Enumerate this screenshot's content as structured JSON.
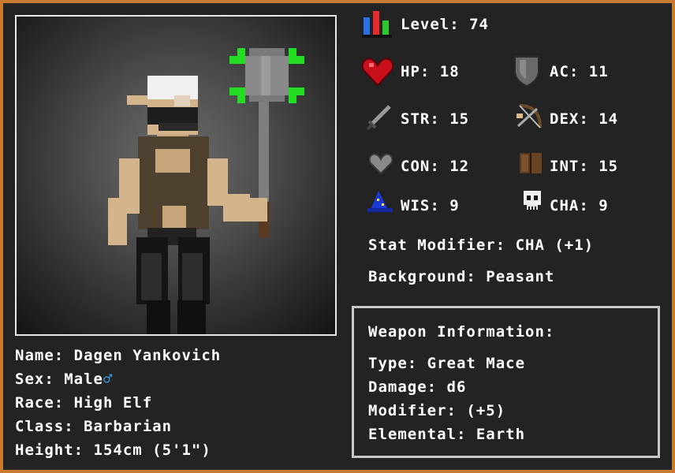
{
  "level": {
    "label": "Level:",
    "value": "74"
  },
  "stats": {
    "hp": {
      "label": "HP:",
      "value": "18"
    },
    "ac": {
      "label": "AC:",
      "value": "11"
    },
    "str": {
      "label": "STR:",
      "value": "15"
    },
    "dex": {
      "label": "DEX:",
      "value": "14"
    },
    "con": {
      "label": "CON:",
      "value": "12"
    },
    "int": {
      "label": "INT:",
      "value": "15"
    },
    "wis": {
      "label": "WIS:",
      "value": "9"
    },
    "cha": {
      "label": "CHA:",
      "value": "9"
    }
  },
  "stat_modifier": {
    "label": "Stat Modifier:",
    "value": "CHA (+1)"
  },
  "background": {
    "label": "Background:",
    "value": "Peasant"
  },
  "character": {
    "name": {
      "label": "Name:",
      "value": "Dagen Yankovich"
    },
    "sex": {
      "label": "Sex:",
      "value": "Male",
      "symbol": "♂"
    },
    "race": {
      "label": "Race:",
      "value": "High Elf"
    },
    "class": {
      "label": "Class:",
      "value": "Barbarian"
    },
    "height": {
      "label": "Height:",
      "value": "154cm (5'1\")"
    }
  },
  "weapon": {
    "title": "Weapon Information:",
    "type": {
      "label": "Type:",
      "value": "Great Mace"
    },
    "damage": {
      "label": "Damage:",
      "value": "d6"
    },
    "modifier": {
      "label": "Modifier:",
      "value": "(+5)"
    },
    "elemental": {
      "label": "Elemental:",
      "value": "Earth"
    }
  },
  "colors": {
    "frame": "#c87a2e",
    "panel": "#232323",
    "text": "#ffffff",
    "element_glow": "#22dd22",
    "male_symbol": "#3aa0e8"
  },
  "icons": {
    "level": "stat-bars-icon",
    "hp": "heart-icon",
    "ac": "shield-icon",
    "str": "sword-icon",
    "dex": "bow-icon",
    "con": "grey-heart-icon",
    "int": "book-icon",
    "wis": "wizard-hat-icon",
    "cha": "skull-icon"
  }
}
